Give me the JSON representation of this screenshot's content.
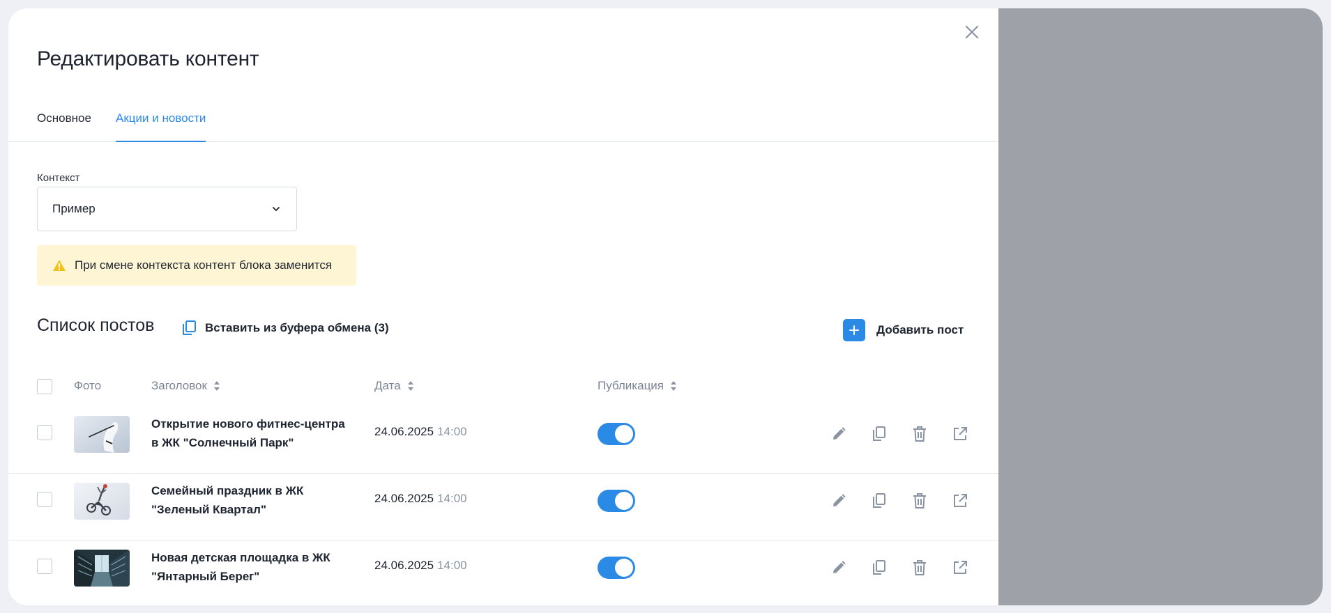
{
  "dialog": {
    "title": "Редактировать контент"
  },
  "tabs": [
    {
      "label": "Основное",
      "active": false
    },
    {
      "label": "Акции и новости",
      "active": true
    }
  ],
  "context": {
    "label": "Контекст",
    "selected": "Пример"
  },
  "warning": {
    "text": "При смене контекста контент блока заменится"
  },
  "posts": {
    "title": "Список постов",
    "paste_label": "Вставить из буфера обмена (3)",
    "add_label": "Добавить пост",
    "columns": {
      "photo": "Фото",
      "title": "Заголовок",
      "date": "Дата",
      "publication": "Публикация"
    },
    "rows": [
      {
        "title": "Открытие нового фитнес-центра в ЖК \"Солнечный Парк\"",
        "date": "24.06.2025",
        "time": "14:00",
        "published": true,
        "photo": "stork"
      },
      {
        "title": "Семейный праздник в ЖК \"Зеленый Квартал\"",
        "date": "24.06.2025",
        "time": "14:00",
        "published": true,
        "photo": "motocross"
      },
      {
        "title": "Новая детская площадка в ЖК \"Янтарный Берег\"",
        "date": "24.06.2025",
        "time": "14:00",
        "published": true,
        "photo": "building"
      }
    ]
  },
  "colors": {
    "accent": "#2b8ae6",
    "warning_bg": "#fdf5d4",
    "warning_icon": "#f2c21b",
    "muted_icon": "#8a93a1",
    "overlay": "#9ea2a8"
  },
  "icons": {
    "close": "close-icon",
    "dropdown": "chevron-down-icon",
    "warning": "warning-icon",
    "paste": "copy-icon",
    "add": "plus-icon",
    "sort": "sort-icon",
    "edit": "pencil-icon",
    "duplicate": "copy-icon",
    "delete": "trash-icon",
    "open": "external-link-icon"
  }
}
